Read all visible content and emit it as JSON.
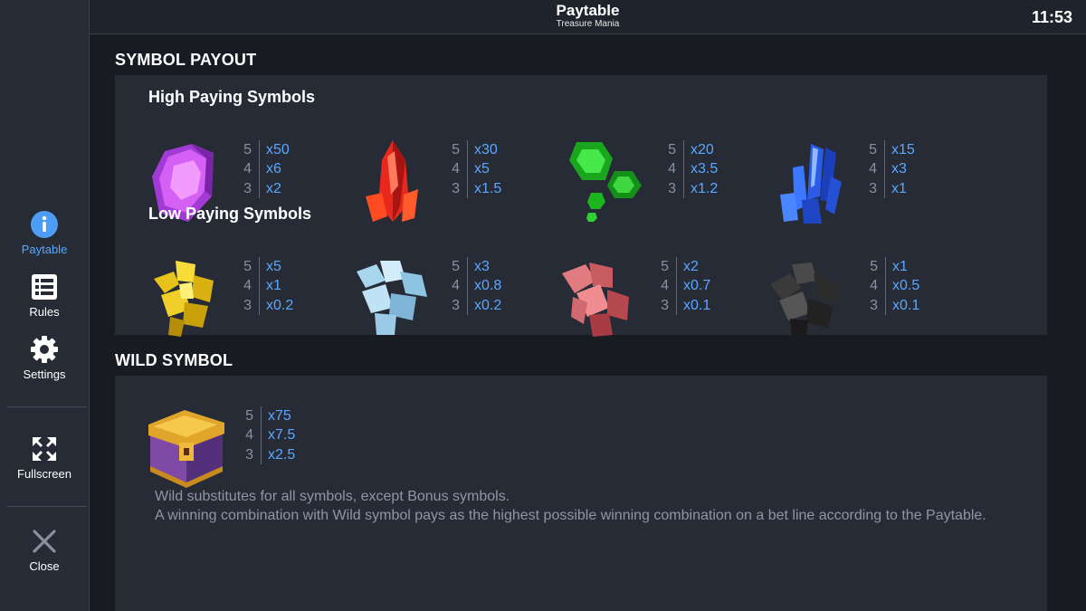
{
  "sidebar": {
    "paytable_label": "Paytable",
    "rules_label": "Rules",
    "settings_label": "Settings",
    "fullscreen_label": "Fullscreen",
    "close_label": "Close"
  },
  "header": {
    "title": "Paytable",
    "subtitle": "Treasure Mania",
    "clock": "11:53"
  },
  "symbol_payout": {
    "title": "SYMBOL PAYOUT",
    "high_title": "High Paying Symbols",
    "low_title": "Low Paying Symbols",
    "high": [
      {
        "icon": "purple-gem-icon",
        "pays": [
          [
            "5",
            "x50"
          ],
          [
            "4",
            "x6"
          ],
          [
            "3",
            "x2"
          ]
        ]
      },
      {
        "icon": "red-crystal-icon",
        "pays": [
          [
            "5",
            "x30"
          ],
          [
            "4",
            "x5"
          ],
          [
            "3",
            "x1.5"
          ]
        ]
      },
      {
        "icon": "green-gems-icon",
        "pays": [
          [
            "5",
            "x20"
          ],
          [
            "4",
            "x3.5"
          ],
          [
            "3",
            "x1.2"
          ]
        ]
      },
      {
        "icon": "blue-crystals-icon",
        "pays": [
          [
            "5",
            "x15"
          ],
          [
            "4",
            "x3"
          ],
          [
            "3",
            "x1"
          ]
        ]
      }
    ],
    "low": [
      {
        "icon": "gold-nugget-icon",
        "pays": [
          [
            "5",
            "x5"
          ],
          [
            "4",
            "x1"
          ],
          [
            "3",
            "x0.2"
          ]
        ]
      },
      {
        "icon": "ice-cubes-icon",
        "pays": [
          [
            "5",
            "x3"
          ],
          [
            "4",
            "x0.8"
          ],
          [
            "3",
            "x0.2"
          ]
        ]
      },
      {
        "icon": "red-rock-icon",
        "pays": [
          [
            "5",
            "x2"
          ],
          [
            "4",
            "x0.7"
          ],
          [
            "3",
            "x0.1"
          ]
        ]
      },
      {
        "icon": "coal-icon",
        "pays": [
          [
            "5",
            "x1"
          ],
          [
            "4",
            "x0.5"
          ],
          [
            "3",
            "x0.1"
          ]
        ]
      }
    ]
  },
  "wild": {
    "title": "WILD SYMBOL",
    "icon": "treasure-chest-icon",
    "pays": [
      [
        "5",
        "x75"
      ],
      [
        "4",
        "x7.5"
      ],
      [
        "3",
        "x2.5"
      ]
    ],
    "line1": "Wild substitutes for all symbols, except Bonus symbols.",
    "line2": "A winning combination with Wild symbol pays as the highest possible winning combination on a bet line according to the Paytable."
  }
}
